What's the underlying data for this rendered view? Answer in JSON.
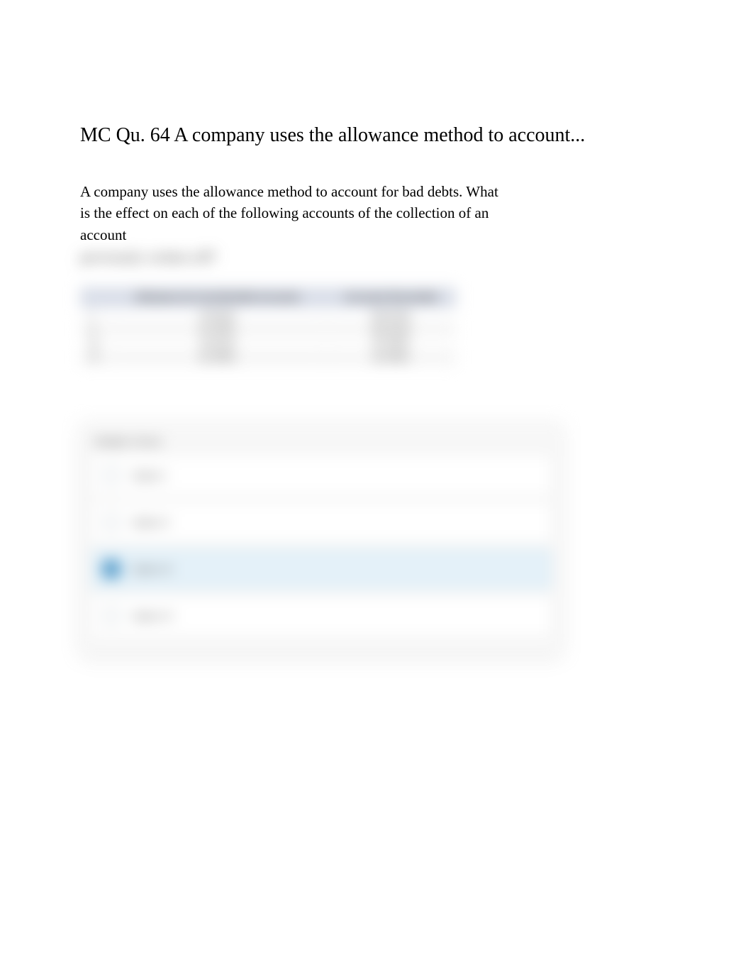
{
  "question": {
    "title": "MC Qu. 64 A company uses the allowance method to account...",
    "body_visible": "A company uses the allowance method to account for bad debts. What is the effect on each of the following accounts of the collection of an account",
    "body_blurred": "previously written off?"
  },
  "table": {
    "headers": {
      "col0": "",
      "col1": "Allowance for Uncollectible Accounts",
      "col2": "Accounts Receivable"
    },
    "rows": [
      {
        "label": "I",
        "col1": "Increase",
        "col2": "Decrease"
      },
      {
        "label": "II",
        "col1": "No effect",
        "col2": "Decrease"
      },
      {
        "label": "III",
        "col1": "Increase",
        "col2": "No effect"
      },
      {
        "label": "IV",
        "col1": "No effect",
        "col2": "No effect"
      }
    ]
  },
  "answers": {
    "header": "Multiple Choice",
    "options": [
      {
        "label": "Option I",
        "selected": false
      },
      {
        "label": "Option II",
        "selected": false
      },
      {
        "label": "Option III",
        "selected": true
      },
      {
        "label": "Option IV",
        "selected": false
      }
    ]
  }
}
